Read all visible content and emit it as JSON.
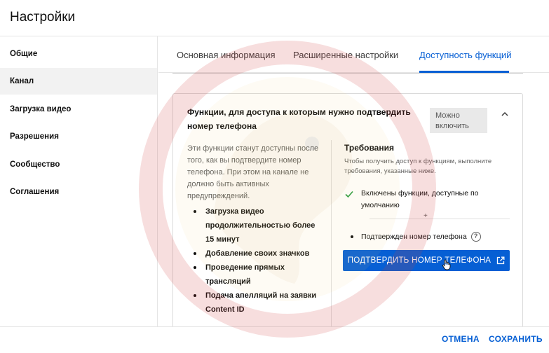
{
  "header": {
    "title": "Настройки"
  },
  "sidebar": {
    "items": [
      {
        "label": "Общие"
      },
      {
        "label": "Канал"
      },
      {
        "label": "Загрузка видео"
      },
      {
        "label": "Разрешения"
      },
      {
        "label": "Сообщество"
      },
      {
        "label": "Соглашения"
      }
    ],
    "active_index": 1
  },
  "tabs": [
    {
      "label": "Основная информация"
    },
    {
      "label": "Расширенные настройки"
    },
    {
      "label": "Доступность функций"
    }
  ],
  "card": {
    "title": "Функции, для доступа к которым нужно подтвердить номер телефона",
    "status": "Можно включить",
    "description": "Эти функции станут доступны после того, как вы подтвердите номер телефона. При этом на канале не должно быть активных предупреждений.",
    "features": [
      "Загрузка видео продолжительностью более 15 минут",
      "Добавление своих значков",
      "Проведение прямых трансляций",
      "Подача апелляций на заявки Content ID"
    ],
    "requirements": {
      "title": "Требования",
      "description": "Чтобы получить доступ к функциям, выполните требования, указанные ниже.",
      "item_done": "Включены функции, доступные по умолчанию",
      "plus": "+",
      "item_pending": "Подтвержден номер телефона",
      "help_glyph": "?",
      "button_label": "ПОДТВЕРДИТЬ НОМЕР ТЕЛЕФОНА"
    }
  },
  "footer": {
    "cancel": "ОТМЕНА",
    "save": "СОХРАНИТЬ"
  },
  "colors": {
    "accent": "#065fd4",
    "check": "#2e9e44",
    "watermark": "#d23b3b"
  },
  "icons": [
    "chevron-up-icon",
    "check-icon",
    "help-icon",
    "external-link-icon",
    "hand-cursor-icon"
  ]
}
